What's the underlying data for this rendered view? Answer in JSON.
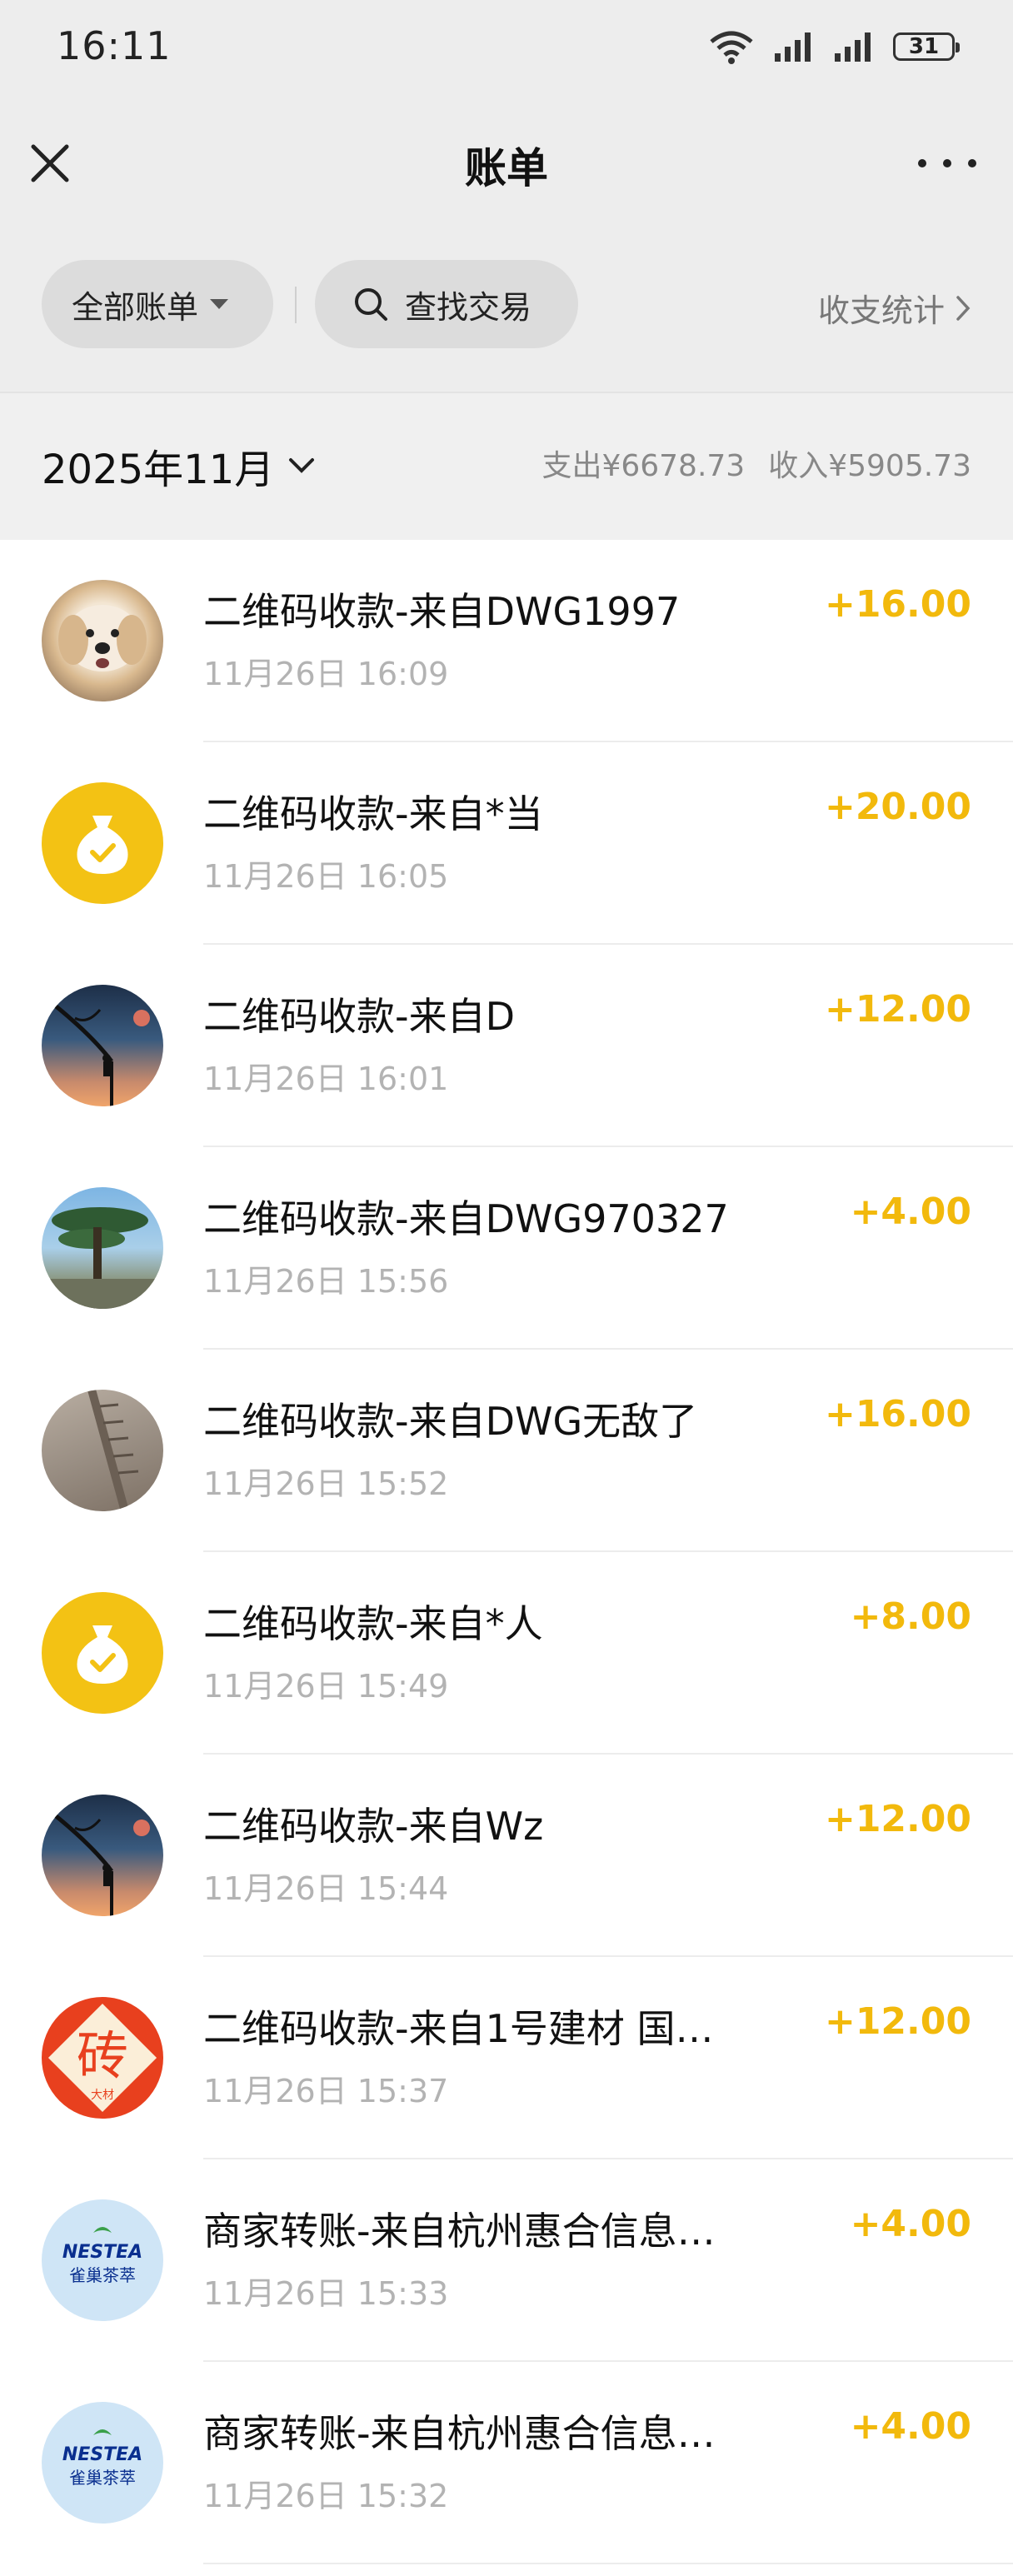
{
  "status_bar": {
    "time": "16:11",
    "battery": "31"
  },
  "nav": {
    "title": "账单"
  },
  "filters": {
    "all_label": "全部账单",
    "search_label": "查找交易",
    "stats_label": "收支统计"
  },
  "month": {
    "label": "2025年11月",
    "expense": "支出¥6678.73",
    "income": "收入¥5905.73"
  },
  "transactions": [
    {
      "title": "二维码收款-来自DWG1997",
      "time": "11月26日 16:09",
      "amount": "+16.00",
      "avatar": "dog-photo"
    },
    {
      "title": "二维码收款-来自*当",
      "time": "11月26日 16:05",
      "amount": "+20.00",
      "avatar": "money-bag-icon"
    },
    {
      "title": "二维码收款-来自D",
      "time": "11月26日 16:01",
      "amount": "+12.00",
      "avatar": "tree-sunset-photo"
    },
    {
      "title": "二维码收款-来自DWG970327",
      "time": "11月26日 15:56",
      "amount": "+4.00",
      "avatar": "pine-tree-photo"
    },
    {
      "title": "二维码收款-来自DWG无敌了",
      "time": "11月26日 15:52",
      "amount": "+16.00",
      "avatar": "stone-path-photo"
    },
    {
      "title": "二维码收款-来自*人",
      "time": "11月26日 15:49",
      "amount": "+8.00",
      "avatar": "money-bag-icon"
    },
    {
      "title": "二维码收款-来自Wz",
      "time": "11月26日 15:44",
      "amount": "+12.00",
      "avatar": "tree-sunset-photo"
    },
    {
      "title": "二维码收款-来自1号建材 国…",
      "time": "11月26日 15:37",
      "amount": "+12.00",
      "avatar": "brick-logo"
    },
    {
      "title": "商家转账-来自杭州惠合信息…",
      "time": "11月26日 15:33",
      "amount": "+4.00",
      "avatar": "nestea-logo"
    },
    {
      "title": "商家转账-来自杭州惠合信息…",
      "time": "11月26日 15:32",
      "amount": "+4.00",
      "avatar": "nestea-logo"
    }
  ],
  "colors": {
    "amount": "#f2b90c",
    "bag": "#f3c214",
    "brick": "#e8401e"
  },
  "logo_text": {
    "brick": "砖",
    "brick_sub": "大材",
    "nestea_top": "NESTEA",
    "nestea_bottom": "雀巢茶萃"
  }
}
